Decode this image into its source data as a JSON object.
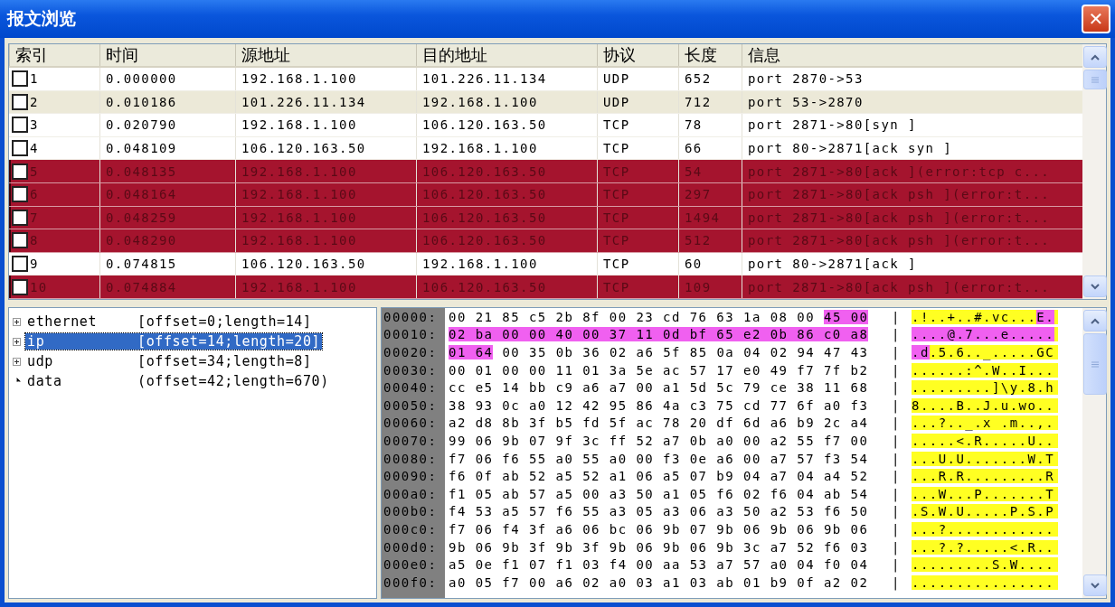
{
  "window": {
    "title": "报文浏览",
    "close": "✕"
  },
  "table": {
    "columns": [
      "索引",
      "时间",
      "源地址",
      "目的地址",
      "协议",
      "长度",
      "信息"
    ],
    "rows": [
      {
        "cells": [
          "1",
          "0.000000",
          "192.168.1.100",
          "101.226.11.134",
          "UDP",
          "652",
          "port 2870->53"
        ],
        "checked": false,
        "error": false,
        "selected": false
      },
      {
        "cells": [
          "2",
          "0.010186",
          "101.226.11.134",
          "192.168.1.100",
          "UDP",
          "712",
          "port 53->2870"
        ],
        "checked": false,
        "error": false,
        "selected": true
      },
      {
        "cells": [
          "3",
          "0.020790",
          "192.168.1.100",
          "106.120.163.50",
          "TCP",
          "78",
          "port 2871->80[syn ]"
        ],
        "checked": false,
        "error": false,
        "selected": false
      },
      {
        "cells": [
          "4",
          "0.048109",
          "106.120.163.50",
          "192.168.1.100",
          "TCP",
          "66",
          "port 80->2871[ack syn ]"
        ],
        "checked": false,
        "error": false,
        "selected": false
      },
      {
        "cells": [
          "5",
          "0.048135",
          "192.168.1.100",
          "106.120.163.50",
          "TCP",
          "54",
          "port 2871->80[ack ](error:tcp c..."
        ],
        "checked": false,
        "error": true,
        "selected": false
      },
      {
        "cells": [
          "6",
          "0.048164",
          "192.168.1.100",
          "106.120.163.50",
          "TCP",
          "297",
          "port 2871->80[ack psh ](error:t..."
        ],
        "checked": false,
        "error": true,
        "selected": false
      },
      {
        "cells": [
          "7",
          "0.048259",
          "192.168.1.100",
          "106.120.163.50",
          "TCP",
          "1494",
          "port 2871->80[ack psh ](error:t..."
        ],
        "checked": false,
        "error": true,
        "selected": false
      },
      {
        "cells": [
          "8",
          "0.048290",
          "192.168.1.100",
          "106.120.163.50",
          "TCP",
          "512",
          "port 2871->80[ack psh ](error:t..."
        ],
        "checked": false,
        "error": true,
        "selected": false
      },
      {
        "cells": [
          "9",
          "0.074815",
          "106.120.163.50",
          "192.168.1.100",
          "TCP",
          "60",
          "port 80->2871[ack ]"
        ],
        "checked": false,
        "error": false,
        "selected": false
      },
      {
        "cells": [
          "10",
          "0.074884",
          "192.168.1.100",
          "106.120.163.50",
          "TCP",
          "109",
          "port 2871->80[ack psh ](error:t..."
        ],
        "checked": false,
        "error": true,
        "selected": false
      }
    ]
  },
  "tree": [
    {
      "name": "ethernet",
      "range": "[offset=0;length=14]",
      "expandable": true,
      "selected": false
    },
    {
      "name": "ip",
      "range": "[offset=14;length=20]",
      "expandable": true,
      "selected": true
    },
    {
      "name": "udp",
      "range": "[offset=34;length=8]",
      "expandable": true,
      "selected": false
    },
    {
      "name": "data",
      "range": "(offset=42;length=670)",
      "expandable": false,
      "selected": false
    }
  ],
  "hex_view": [
    {
      "offset": "00000:",
      "hex": [
        {
          "text": "00 21 85 c5 2b 8f 00 23 cd 76 63 1a 08 00",
          "highlighted": false
        },
        {
          "text": "45 00",
          "highlighted": true
        }
      ],
      "sep": "|",
      "ascii": [
        {
          "text": ".!..+..#.vc...",
          "highlighted": false
        },
        {
          "text": "E.",
          "highlighted": true
        }
      ]
    },
    {
      "offset": "00010:",
      "hex": [
        {
          "text": "02 ba 00 00 40 00 37 11 0d bf 65 e2 0b 86 c0 a8",
          "highlighted": true
        }
      ],
      "sep": "|",
      "ascii": [
        {
          "text": "....@.7...e.....",
          "highlighted": true
        }
      ]
    },
    {
      "offset": "00020:",
      "hex": [
        {
          "text": "01 64",
          "highlighted": true
        },
        {
          "text": "00 35 0b 36 02 a6 5f 85 0a 04 02 94 47 43",
          "highlighted": false
        }
      ],
      "sep": "|",
      "ascii": [
        {
          "text": ".d",
          "highlighted": true
        },
        {
          "text": ".5.6.._.....GC",
          "highlighted": false
        }
      ]
    },
    {
      "offset": "00030:",
      "hex": [
        {
          "text": "00 01 00 00 11 01 3a 5e ac 57 17 e0 49 f7 7f b2",
          "highlighted": false
        }
      ],
      "sep": "|",
      "ascii": [
        {
          "text": "......:^.W..I...",
          "highlighted": false
        }
      ]
    },
    {
      "offset": "00040:",
      "hex": [
        {
          "text": "cc e5 14 bb c9 a6 a7 00 a1 5d 5c 79 ce 38 11 68",
          "highlighted": false
        }
      ],
      "sep": "|",
      "ascii": [
        {
          "text": ".........]\\y.8.h",
          "highlighted": false
        }
      ]
    },
    {
      "offset": "00050:",
      "hex": [
        {
          "text": "38 93 0c a0 12 42 95 86 4a c3 75 cd 77 6f a0 f3",
          "highlighted": false
        }
      ],
      "sep": "|",
      "ascii": [
        {
          "text": "8....B..J.u.wo..",
          "highlighted": false
        }
      ]
    },
    {
      "offset": "00060:",
      "hex": [
        {
          "text": "a2 d8 8b 3f b5 fd 5f ac 78 20 df 6d a6 b9 2c a4",
          "highlighted": false
        }
      ],
      "sep": "|",
      "ascii": [
        {
          "text": "...?.._.x .m..,.",
          "highlighted": false
        }
      ]
    },
    {
      "offset": "00070:",
      "hex": [
        {
          "text": "99 06 9b 07 9f 3c ff 52 a7 0b a0 00 a2 55 f7 00",
          "highlighted": false
        }
      ],
      "sep": "|",
      "ascii": [
        {
          "text": ".....<.R.....U..",
          "highlighted": false
        }
      ]
    },
    {
      "offset": "00080:",
      "hex": [
        {
          "text": "f7 06 f6 55 a0 55 a0 00 f3 0e a6 00 a7 57 f3 54",
          "highlighted": false
        }
      ],
      "sep": "|",
      "ascii": [
        {
          "text": "...U.U.......W.T",
          "highlighted": false
        }
      ]
    },
    {
      "offset": "00090:",
      "hex": [
        {
          "text": "f6 0f ab 52 a5 52 a1 06 a5 07 b9 04 a7 04 a4 52",
          "highlighted": false
        }
      ],
      "sep": "|",
      "ascii": [
        {
          "text": "...R.R.........R",
          "highlighted": false
        }
      ]
    },
    {
      "offset": "000a0:",
      "hex": [
        {
          "text": "f1 05 ab 57 a5 00 a3 50 a1 05 f6 02 f6 04 ab 54",
          "highlighted": false
        }
      ],
      "sep": "|",
      "ascii": [
        {
          "text": "...W...P.......T",
          "highlighted": false
        }
      ]
    },
    {
      "offset": "000b0:",
      "hex": [
        {
          "text": "f4 53 a5 57 f6 55 a3 05 a3 06 a3 50 a2 53 f6 50",
          "highlighted": false
        }
      ],
      "sep": "|",
      "ascii": [
        {
          "text": ".S.W.U.....P.S.P",
          "highlighted": false
        }
      ]
    },
    {
      "offset": "000c0:",
      "hex": [
        {
          "text": "f7 06 f4 3f a6 06 bc 06 9b 07 9b 06 9b 06 9b 06",
          "highlighted": false
        }
      ],
      "sep": "|",
      "ascii": [
        {
          "text": "...?............",
          "highlighted": false
        }
      ]
    },
    {
      "offset": "000d0:",
      "hex": [
        {
          "text": "9b 06 9b 3f 9b 3f 9b 06 9b 06 9b 3c a7 52 f6 03",
          "highlighted": false
        }
      ],
      "sep": "|",
      "ascii": [
        {
          "text": "...?.?.....<.R..",
          "highlighted": false
        }
      ]
    },
    {
      "offset": "000e0:",
      "hex": [
        {
          "text": "a5 0e f1 07 f1 03 f4 00 aa 53 a7 57 a0 04 f0 04",
          "highlighted": false
        }
      ],
      "sep": "|",
      "ascii": [
        {
          "text": ".........S.W....",
          "highlighted": false
        }
      ]
    },
    {
      "offset": "000f0:",
      "hex": [
        {
          "text": "a0 05 f7 00 a6 02 a0 03 a1 03 ab 01 b9 0f a2 02",
          "highlighted": false
        }
      ],
      "sep": "|",
      "ascii": [
        {
          "text": "................",
          "highlighted": false
        }
      ]
    }
  ]
}
